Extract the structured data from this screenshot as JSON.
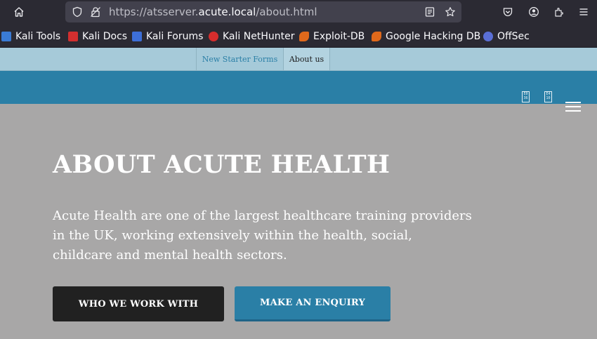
{
  "browser": {
    "url_prefix": "https://atsserver.",
    "url_domain": "acute.local",
    "url_suffix": "/about.html"
  },
  "bookmarks": [
    {
      "label": "Kali Tools",
      "color": "#3a7bd5"
    },
    {
      "label": "Kali Docs",
      "color": "#d32f2f"
    },
    {
      "label": "Kali Forums",
      "color": "#3d6fd8"
    },
    {
      "label": "Kali NetHunter",
      "color": "#d62d2d"
    },
    {
      "label": "Exploit-DB",
      "color": "#e0691b"
    },
    {
      "label": "Google Hacking DB",
      "color": "#e0691b"
    },
    {
      "label": "OffSec",
      "color": "#5a6fd6"
    }
  ],
  "site": {
    "nav": [
      {
        "label": "New Starter Forms",
        "active": false
      },
      {
        "label": "About us",
        "active": true
      }
    ],
    "flags": [
      {
        "top": "E0",
        "bottom": "36"
      },
      {
        "top": "E4",
        "bottom": "10"
      }
    ],
    "heading": "ABOUT ACUTE HEALTH",
    "intro": "Acute Health are one of the largest healthcare training providers in the UK, working extensively within the health, social, childcare and mental health sectors.",
    "buttons": {
      "primary": "WHO WE WORK WITH",
      "secondary": "MAKE AN ENQUIRY"
    }
  },
  "colors": {
    "toolbar_bg": "#2b2a33",
    "nav_bg": "#a6cad9",
    "brand_blue": "#2a7fa6",
    "hero_bg": "#a8a7a7"
  }
}
